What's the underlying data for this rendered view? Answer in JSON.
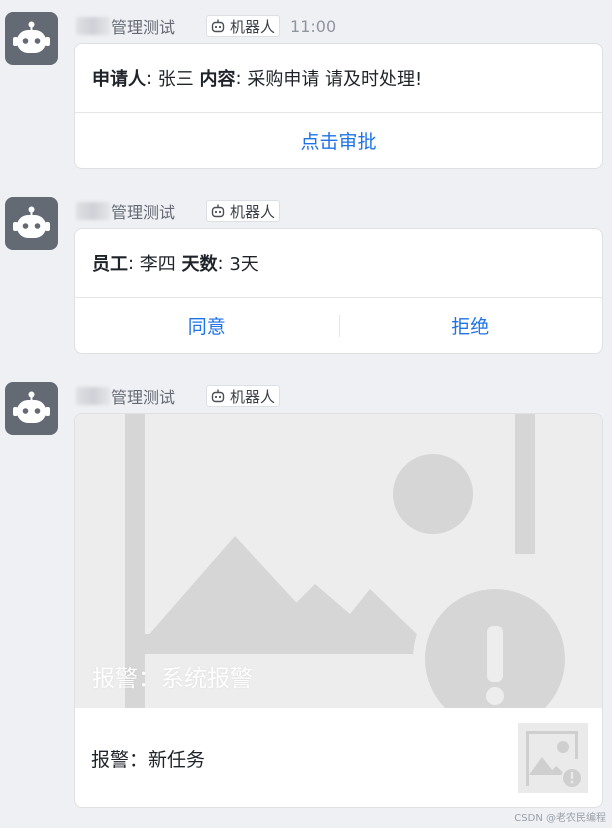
{
  "messages": [
    {
      "sender_suffix": "管理测试",
      "bot_tag": "机器人",
      "time": "11:00",
      "card": {
        "fields": [
          {
            "label": "申请人",
            "value": "张三"
          },
          {
            "label": "内容",
            "value": "采购申请 请及时处理!"
          }
        ],
        "action": "点击审批"
      }
    },
    {
      "sender_suffix": "管理测试",
      "bot_tag": "机器人",
      "card": {
        "fields": [
          {
            "label": "员工",
            "value": "李四"
          },
          {
            "label": "天数",
            "value": "3天"
          }
        ],
        "actions": [
          "同意",
          "拒绝"
        ]
      }
    },
    {
      "sender_suffix": "管理测试",
      "bot_tag": "机器人",
      "card": {
        "image_caption": "报警：系统报警",
        "text": "报警：新任务",
        "image_icon": "broken-image-icon",
        "thumb_icon": "broken-image-icon"
      }
    }
  ],
  "icons": {
    "avatar": "robot-icon",
    "bot_tag": "robot-icon"
  },
  "colors": {
    "background": "#eff0f4",
    "avatar": "#646a73",
    "link": "#1e73e8",
    "placeholder_gray": "#d6d6d6"
  },
  "watermark": "CSDN @老农民编程"
}
